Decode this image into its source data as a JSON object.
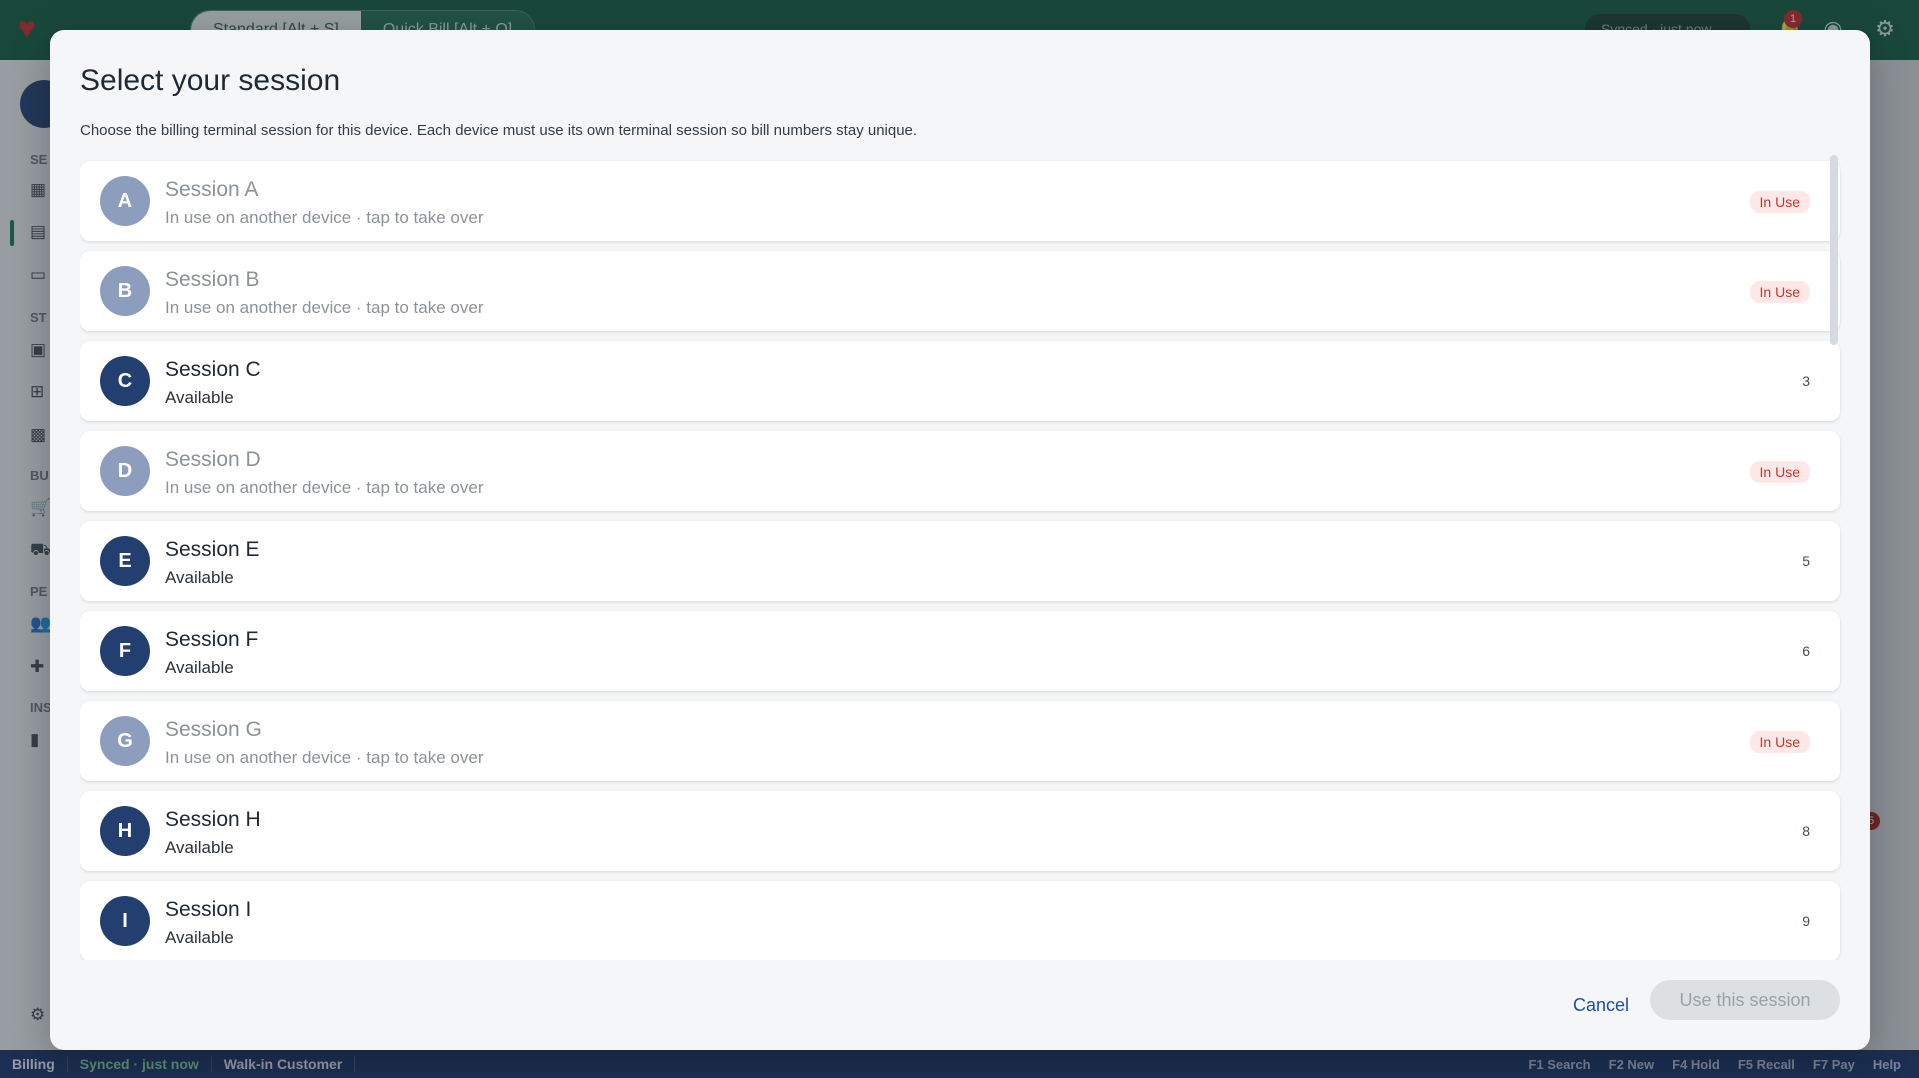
{
  "app": {
    "tabs": [
      "Standard [Alt + S]",
      "Quick Bill [Alt + Q]"
    ],
    "sync_pill": "Synced · just now",
    "notification_count": "1",
    "sidebar_labels": [
      "SE",
      "ST",
      "BU",
      "PE",
      "INS"
    ],
    "right_badge": "5"
  },
  "statusbar": {
    "module": "Billing",
    "sync": "Synced · just now",
    "customer": "Walk-in Customer",
    "shortcuts": [
      "F1 Search",
      "F2 New",
      "F4 Hold",
      "F5 Recall",
      "F7 Pay",
      "Help"
    ]
  },
  "dialog": {
    "title": "Select your session",
    "subtitle": "Choose the billing terminal session for this device. Each device must use its own terminal session so bill numbers stay unique.",
    "cancel_label": "Cancel",
    "confirm_label": "Use this session",
    "sessions": [
      {
        "initial": "A",
        "name": "Session A",
        "status": "In use on another device · tap to take over",
        "badge": "In Use",
        "in_use": true
      },
      {
        "initial": "B",
        "name": "Session B",
        "status": "In use on another device · tap to take over",
        "badge": "In Use",
        "in_use": true
      },
      {
        "initial": "C",
        "name": "Session C",
        "status": "Available",
        "count": "3",
        "in_use": false
      },
      {
        "initial": "D",
        "name": "Session D",
        "status": "In use on another device · tap to take over",
        "badge": "In Use",
        "in_use": true
      },
      {
        "initial": "E",
        "name": "Session E",
        "status": "Available",
        "count": "5",
        "in_use": false
      },
      {
        "initial": "F",
        "name": "Session F",
        "status": "Available",
        "count": "6",
        "in_use": false
      },
      {
        "initial": "G",
        "name": "Session G",
        "status": "In use on another device · tap to take over",
        "badge": "In Use",
        "in_use": true
      },
      {
        "initial": "H",
        "name": "Session H",
        "status": "Available",
        "count": "8",
        "in_use": false
      },
      {
        "initial": "I",
        "name": "Session I",
        "status": "Available",
        "count": "9",
        "in_use": false
      }
    ]
  }
}
